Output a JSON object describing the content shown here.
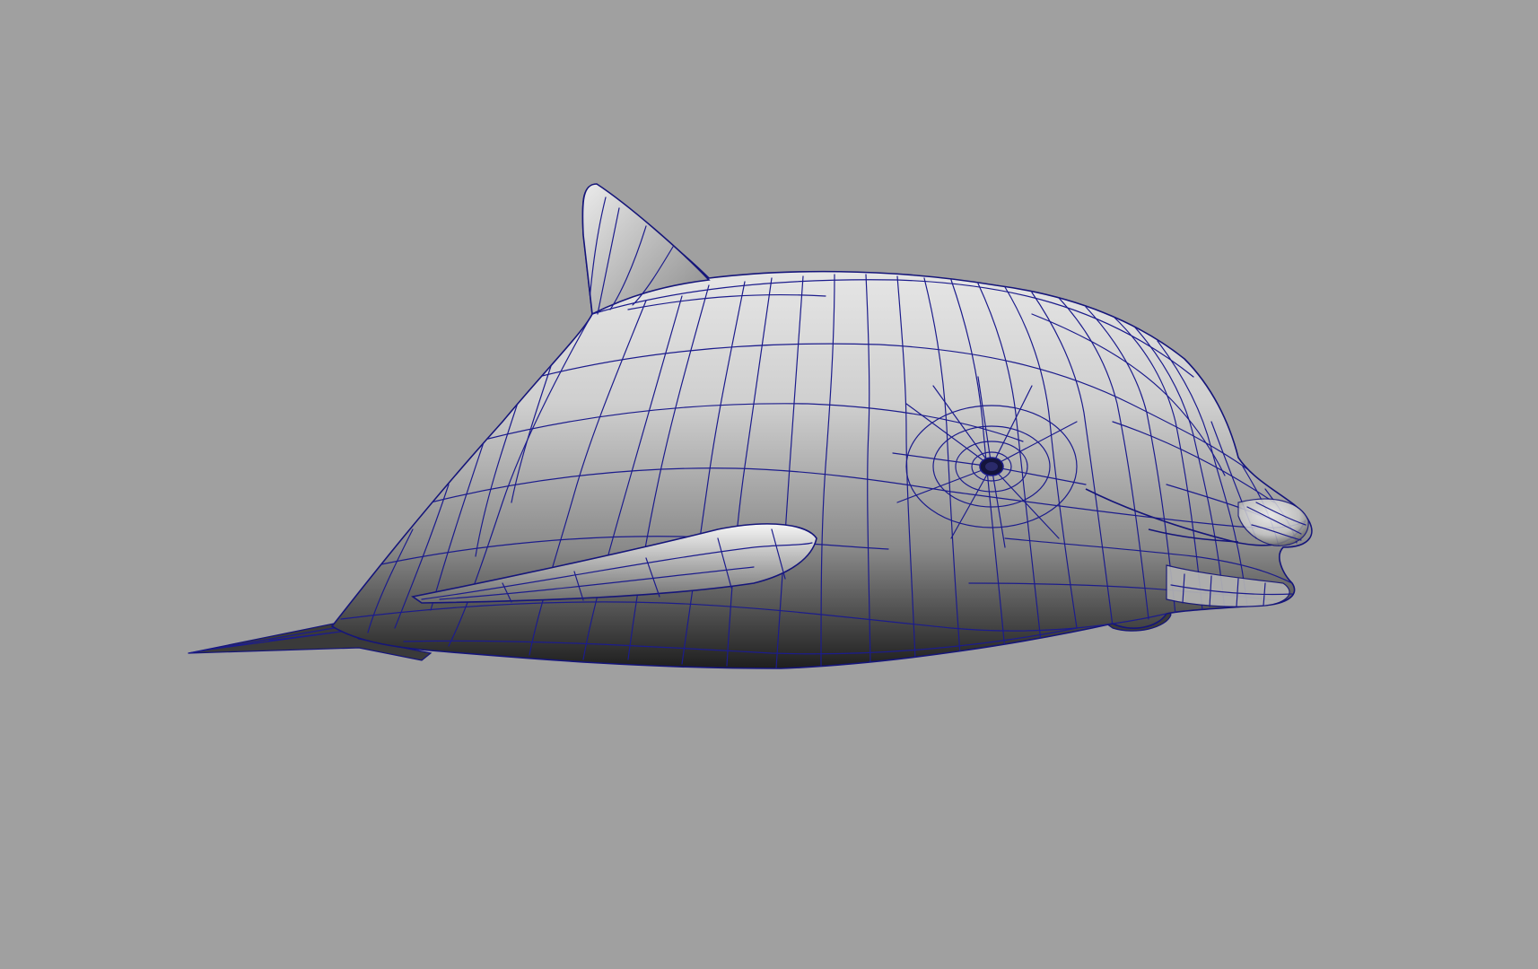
{
  "viewport": {
    "background_color": "#a0a0a0",
    "wireframe_color": "#1c1c8c",
    "shading": "smooth-shaded-with-wireframe-on-shaded",
    "model_name": "dolphin",
    "view": "perspective"
  },
  "colors": {
    "surface_highlight": "#f2f2f2",
    "surface_mid": "#bdbdbd",
    "surface_shadow": "#1a1a1a"
  }
}
